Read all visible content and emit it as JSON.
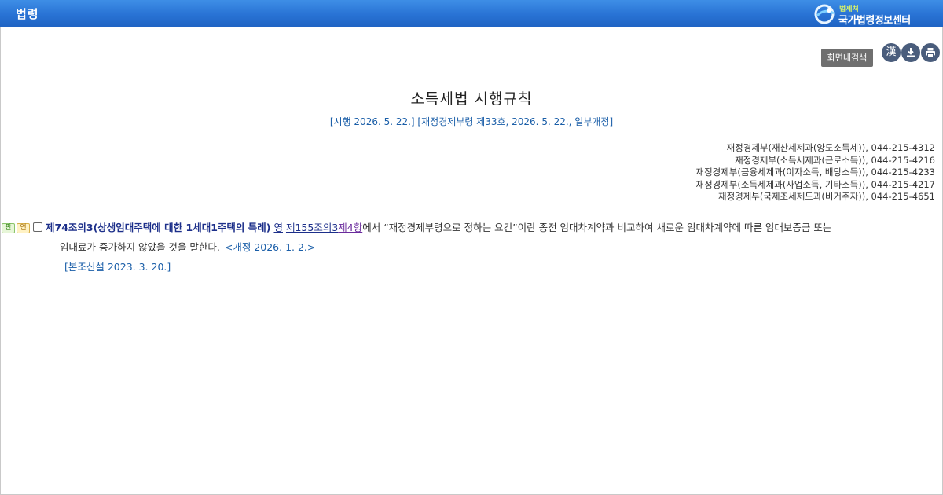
{
  "topbar": {
    "title": "법령",
    "logo_small": "법제처",
    "logo_big": "국가법령정보센터"
  },
  "toolbar": {
    "search_label": "화면내검색",
    "hanja_label": "漢"
  },
  "document": {
    "title": "소득세법 시행규칙",
    "subtitle": "[시행 2026. 5. 22.] [재정경제부령 제33호, 2026. 5. 22., 일부개정]",
    "contacts": [
      "재정경제부(재산세제과(양도소득세)), 044-215-4312",
      "재정경제부(소득세제과(근로소득)), 044-215-4216",
      "재정경제부(금융세제과(이자소득, 배당소득)), 044-215-4233",
      "재정경제부(소득세제과(사업소득, 기타소득)), 044-215-4217",
      "재정경제부(국제조세제도과(비거주자)), 044-215-4651"
    ]
  },
  "article": {
    "tag_pan": "판",
    "tag_yeon": "연",
    "title": "제74조의3(상생임대주택에 대한 1세대1주택의 특례)",
    "ref_prefix": "영",
    "ref_link_a": "제155조의3",
    "ref_link_b": "제4항",
    "body_line1": "에서 “재정경제부령으로 정하는 요건”이란 종전 임대차계약과 비교하여 새로운 임대차계약에 따른 임대보증금 또는",
    "body_line2": "임대료가 증가하지 않았을 것을 말한다.",
    "amend_note": "<개정 2026. 1. 2.>",
    "origin_note": "[본조신설 2023. 3. 20.]"
  }
}
